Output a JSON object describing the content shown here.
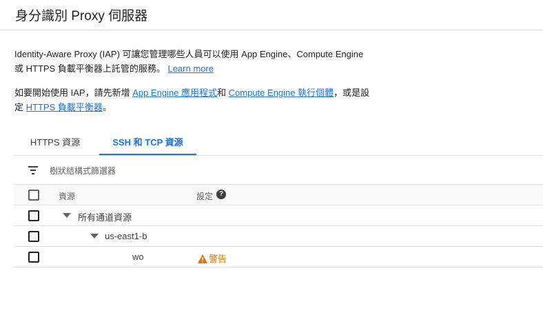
{
  "header": {
    "title": "身分識別 Proxy 伺服器"
  },
  "intro": {
    "line1": "Identity-Aware Proxy (IAP) 可讓您管理哪些人員可以使用 App Engine、Compute Engine",
    "line2": "或 HTTPS 負載平衡器上託管的服務。",
    "learn_more": "Learn more"
  },
  "getting_started": {
    "prefix": "如要開始使用 IAP，請先新增 ",
    "app_engine_link": "App Engine 應用程式",
    "and": "和 ",
    "compute_link": "Compute Engine 執行個體",
    "or": "，或是設",
    "line2_prefix": "定 ",
    "https_link": "HTTPS 負載平衡器",
    "end": "。"
  },
  "tabs": [
    {
      "label": "HTTPS 資源",
      "active": false
    },
    {
      "label": "SSH 和 TCP 資源",
      "active": true
    }
  ],
  "filter": {
    "placeholder": "樹狀結構式篩選器",
    "icon": "filter-list-icon"
  },
  "table": {
    "columns": {
      "resource": "資源",
      "settings": "設定"
    },
    "rows": [
      {
        "name": "所有通道資源",
        "level": 0,
        "expandable": true,
        "setting": ""
      },
      {
        "name": "us-east1-b",
        "level": 1,
        "expandable": true,
        "setting": ""
      },
      {
        "name": "wo",
        "level": 2,
        "expandable": false,
        "setting": "警告"
      }
    ]
  },
  "colors": {
    "accent": "#1a73e8",
    "warning": "#e37400"
  }
}
